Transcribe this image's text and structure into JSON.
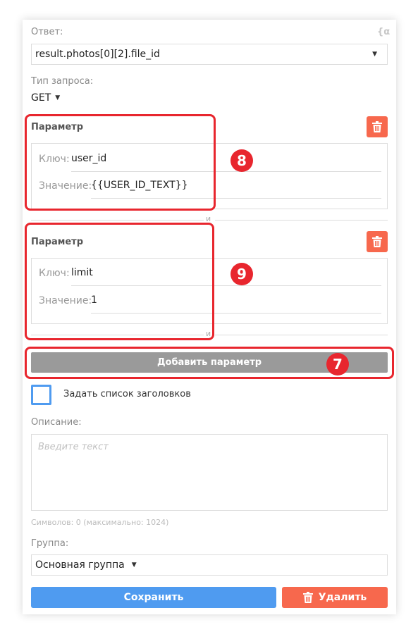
{
  "response": {
    "label": "Ответ:",
    "icon": "alpha-icon",
    "value": "result.photos[0][2].file_id",
    "icon_glyph": "{α"
  },
  "request_type": {
    "label": "Тип запроса:",
    "value": "GET"
  },
  "params": [
    {
      "title": "Параметр",
      "key_label": "Ключ:",
      "key_value": "user_id",
      "value_label": "Значение:",
      "value_value": "{{USER_ID_TEXT}}",
      "separator": "и"
    },
    {
      "title": "Параметр",
      "key_label": "Ключ:",
      "key_value": "limit",
      "value_label": "Значение:",
      "value_value": "1",
      "separator": "и"
    }
  ],
  "add_param_label": "Добавить параметр",
  "headers_checkbox": {
    "label": "Задать список заголовков",
    "checked": false
  },
  "description": {
    "label": "Описание:",
    "placeholder": "Введите текст",
    "counter": "Символов: 0 (максимально: 1024)"
  },
  "group": {
    "label": "Группа:",
    "value": "Основная группа"
  },
  "actions": {
    "save_label": "Сохранить",
    "delete_label": "Удалить"
  },
  "annotations": [
    {
      "number": "8"
    },
    {
      "number": "9"
    },
    {
      "number": "7"
    }
  ],
  "colors": {
    "accent_blue": "#4f9bf0",
    "danger_orange": "#f7684d",
    "annotation_red": "#e8262e",
    "button_gray": "#9a9a9a"
  }
}
